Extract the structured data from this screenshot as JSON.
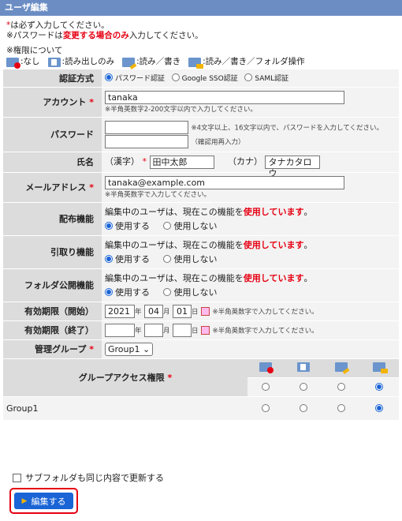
{
  "title": "ユーザ編集",
  "notes": {
    "required_mark": "*",
    "required_text": "は必ず入力してください。",
    "pw_prefix": "※パスワードは",
    "pw_emph": "変更する場合のみ",
    "pw_suffix": "入力してください。"
  },
  "permissions": {
    "title": "※権限について",
    "items": [
      {
        "icon": "no-access-icon",
        "label": ":なし"
      },
      {
        "icon": "read-only-icon",
        "label": ":読み出しのみ"
      },
      {
        "icon": "read-write-icon",
        "label": ":読み／書き"
      },
      {
        "icon": "read-write-folder-icon",
        "label": ":読み／書き／フォルダ操作"
      }
    ]
  },
  "form": {
    "auth": {
      "label": "認証方式",
      "options": [
        "パスワード認証",
        "Google SSO認証",
        "SAML認証"
      ],
      "selected": "パスワード認証"
    },
    "account": {
      "label": "アカウント",
      "value": "tanaka",
      "hint": "※半角英数字2-200文字以内で入力してください。"
    },
    "password": {
      "label": "パスワード",
      "hint": "※4文字以上、16文字以内で、パスワードを入力してください。",
      "confirm_hint": "（確認用再入力）"
    },
    "name": {
      "label": "氏名",
      "kanji_label": "（漢字）",
      "kanji_value": "田中太郎",
      "kana_label": "（カナ）",
      "kana_value": "タナカタロウ"
    },
    "email": {
      "label": "メールアドレス",
      "value": "tanaka@example.com",
      "hint": "※半角英数字で入力してください。"
    },
    "features": [
      {
        "label": "配布機能",
        "msg_pre": "編集中のユーザは、現在この機能を",
        "msg_emph": "使用しています",
        "msg_post": "。",
        "use": "使用する",
        "nouse": "使用しない",
        "selected": "use"
      },
      {
        "label": "引取り機能",
        "msg_pre": "編集中のユーザは、現在この機能を",
        "msg_emph": "使用しています",
        "msg_post": "。",
        "use": "使用する",
        "nouse": "使用しない",
        "selected": "use"
      },
      {
        "label": "フォルダ公開機能",
        "msg_pre": "編集中のユーザは、現在この機能を",
        "msg_emph": "使用しています",
        "msg_post": "。",
        "use": "使用する",
        "nouse": "使用しない",
        "selected": "use"
      }
    ],
    "valid_start": {
      "label": "有効期限（開始）",
      "year": "2021",
      "month": "04",
      "day": "01",
      "y_unit": "年",
      "m_unit": "月",
      "d_unit": "日",
      "hint": "※半角英数字で入力してください。"
    },
    "valid_end": {
      "label": "有効期限（終了）",
      "year": "",
      "month": "",
      "day": "",
      "y_unit": "年",
      "m_unit": "月",
      "d_unit": "日",
      "hint": "※半角英数字で入力してください。"
    },
    "group": {
      "label": "管理グループ",
      "value": "Group1"
    },
    "group_access": {
      "label": "グループアクセス権限",
      "rows": [
        {
          "name": "",
          "selected": 3
        },
        {
          "name": "Group1",
          "selected": 3
        }
      ]
    }
  },
  "subfolder": {
    "label": "サブフォルダも同じ内容で更新する",
    "checked": false
  },
  "submit": {
    "label": "編集する"
  }
}
